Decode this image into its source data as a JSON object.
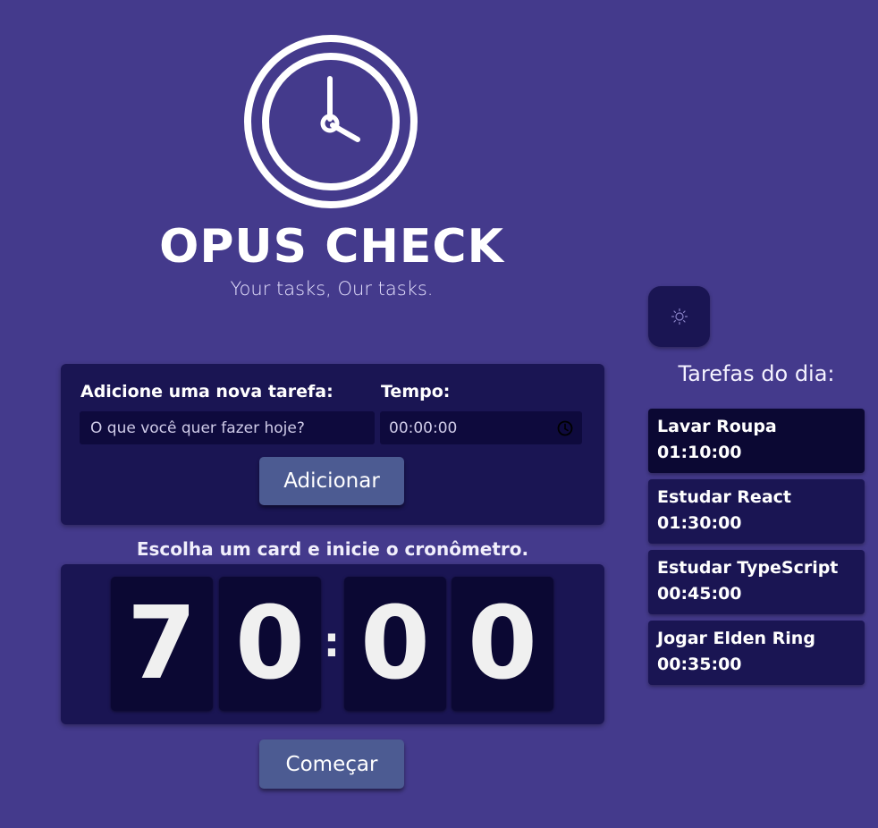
{
  "brand": {
    "title": "OPUS CHECK",
    "subtitle": "Your tasks, Our tasks."
  },
  "theme_toggle": {
    "icon": "sun-icon"
  },
  "add_task": {
    "task_label": "Adicione uma nova tarefa:",
    "task_placeholder": "O que você quer fazer hoje?",
    "time_label": "Tempo:",
    "time_value": "00:00:00",
    "time_icon": "clock-icon",
    "add_button": "Adicionar"
  },
  "timer": {
    "caption": "Escolha um card e inicie o cronômetro.",
    "digits": [
      "7",
      "0",
      "0",
      "0"
    ],
    "separator": ":",
    "start_button": "Começar"
  },
  "tasks": {
    "heading": "Tarefas do dia:",
    "items": [
      {
        "name": "Lavar Roupa",
        "time": "01:10:00"
      },
      {
        "name": "Estudar React",
        "time": "01:30:00"
      },
      {
        "name": "Estudar TypeScript",
        "time": "00:45:00"
      },
      {
        "name": "Jogar Elden Ring",
        "time": "00:35:00"
      }
    ]
  },
  "colors": {
    "background": "#443a8c",
    "panel": "#1a1553",
    "digit_card": "#0b0833",
    "button": "#4c5b92"
  }
}
